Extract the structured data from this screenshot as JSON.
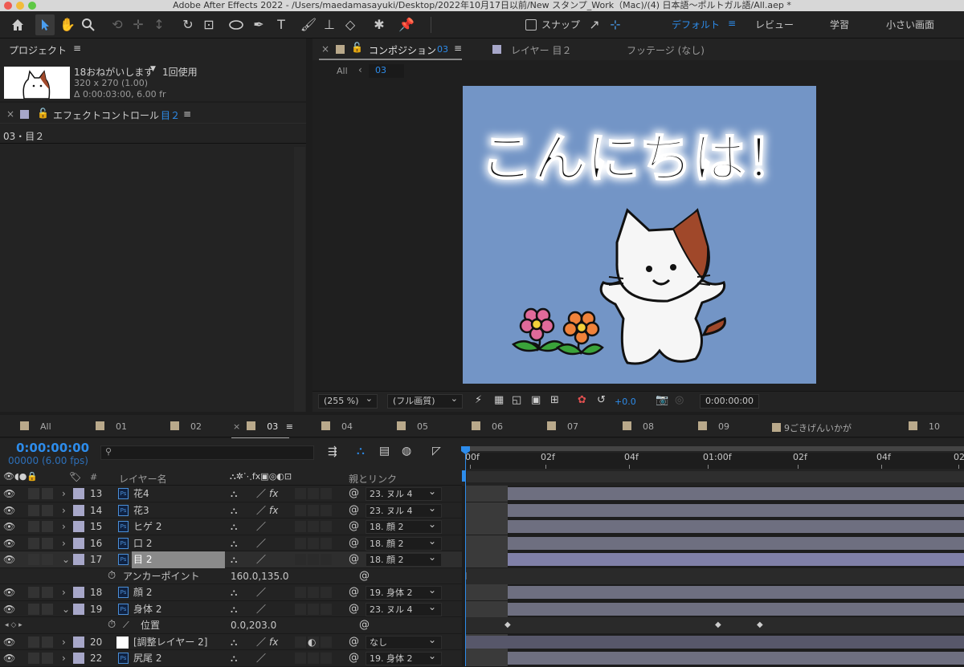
{
  "window": {
    "title": "Adobe After Effects 2022 - /Users/maedamasayuki/Desktop/2022年10月17日以前/New スタンプ_Work（Mac)/(4) 日本語〜ポルトガル語/All.aep *"
  },
  "toolbar": {
    "snap_label": "スナップ",
    "workspaces": [
      "デフォルト",
      "≡",
      "レビュー",
      "学習",
      "小さい画面"
    ]
  },
  "project_panel": {
    "title": "プロジェクト",
    "item_name": "18おねがいします",
    "item_usage": "1回使用",
    "item_size": "320 x 270 (1.00)",
    "item_duration": "Δ 0:00:03:00, 6.00 fr"
  },
  "effect_panel": {
    "title": "エフェクトコントロール",
    "layer": "目２",
    "path": "03・目２"
  },
  "comp_panel": {
    "title": "コンポジション",
    "comp_name": "03",
    "layer_tab": "レイヤー 目２",
    "footage_tab": "フッテージ (なし)",
    "nav_all": "All",
    "nav_comp": "03",
    "canvas_text": "こんにちは！",
    "zoom": "(255 %)",
    "quality": "(フル画質)",
    "exposure": "+0.0",
    "timecode": "0:00:00:00"
  },
  "timeline_tabs": [
    "All",
    "01",
    "02",
    "03",
    "04",
    "05",
    "06",
    "07",
    "08",
    "09",
    "9ごきげんいかが",
    "10"
  ],
  "timeline": {
    "current_time": "0:00:00:00",
    "frame_info": "00000 (6.00 fps)",
    "search_placeholder": "",
    "col_layer_name": "レイヤー名",
    "col_parent": "親とリンク",
    "col_num": "#",
    "ruler": [
      "00f",
      "02f",
      "04f",
      "01:00f",
      "02f",
      "04f",
      "02"
    ],
    "layers": [
      {
        "num": "13",
        "name": "花4",
        "fx": true,
        "parent": "23. ヌル 4",
        "kind": "layer"
      },
      {
        "num": "14",
        "name": "花3",
        "fx": true,
        "parent": "23. ヌル 4",
        "kind": "layer"
      },
      {
        "num": "15",
        "name": "ヒゲ 2",
        "fx": false,
        "parent": "18. 顔 2",
        "kind": "layer"
      },
      {
        "num": "16",
        "name": "口 2",
        "fx": false,
        "parent": "18. 顔 2",
        "kind": "layer"
      },
      {
        "num": "17",
        "name": "目 2",
        "fx": false,
        "parent": "18. 顔 2",
        "kind": "selected"
      },
      {
        "name": "アンカーポイント",
        "value": "160.0,135.0",
        "kind": "prop"
      },
      {
        "num": "18",
        "name": "顔 2",
        "fx": false,
        "parent": "19. 身体 2",
        "kind": "layer"
      },
      {
        "num": "19",
        "name": "身体 2",
        "fx": false,
        "parent": "23. ヌル 4",
        "kind": "layer"
      },
      {
        "name": "位置",
        "value": "0.0,203.0",
        "kind": "prop-key"
      },
      {
        "num": "20",
        "name": "[調整レイヤー 2]",
        "fx": true,
        "parent": "なし",
        "kind": "adjust"
      },
      {
        "num": "22",
        "name": "尻尾 2",
        "fx": false,
        "parent": "19. 身体 2",
        "kind": "layer"
      }
    ]
  }
}
